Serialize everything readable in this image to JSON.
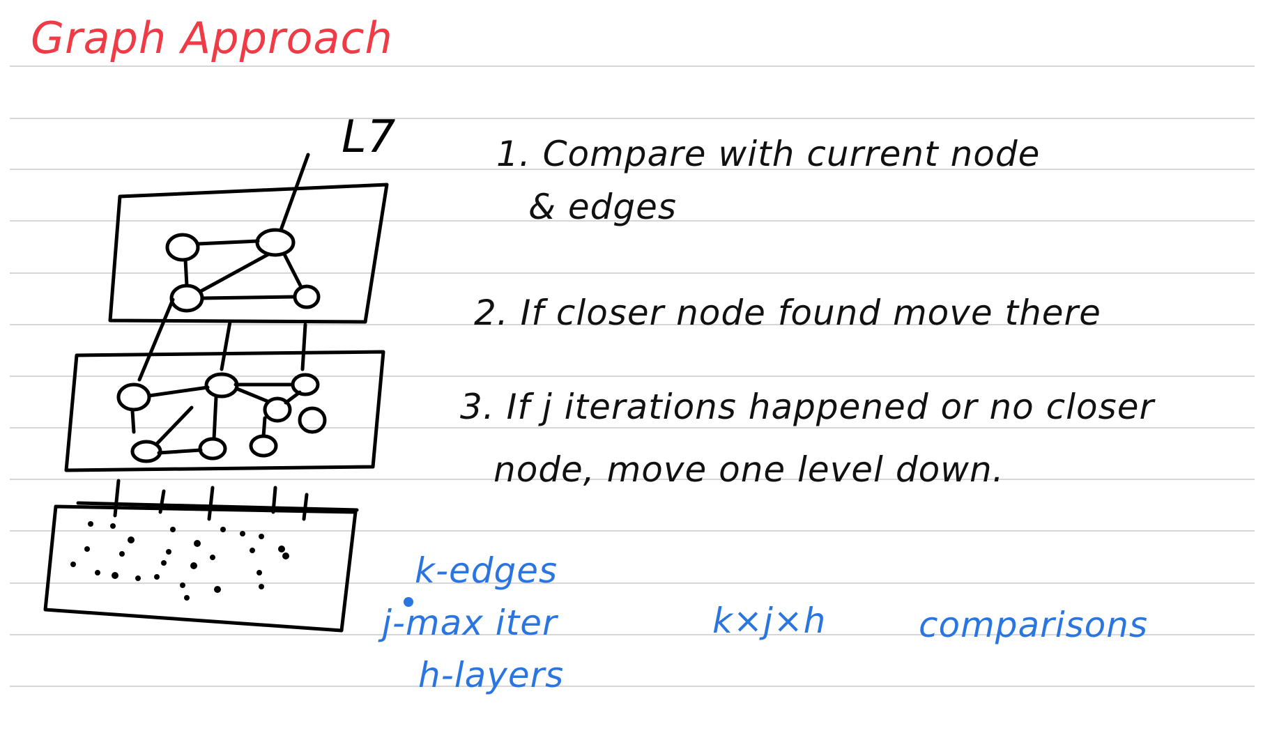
{
  "title": "Graph Approach",
  "layer_label": "L7",
  "steps": [
    {
      "line1": "1. Compare with current node",
      "line2": "& edges"
    },
    {
      "line1": "2. If closer node found move there"
    },
    {
      "line1": "3. If j iterations happened or no closer",
      "line2": "node, move one level down."
    }
  ],
  "params": {
    "k": "k-edges",
    "j": "j-max iter",
    "h": "h-layers"
  },
  "formula": "k×j×h",
  "comparisons": "comparisons",
  "colors": {
    "title": "#ef3b46",
    "ink": "#111111",
    "blue": "#2a75e0",
    "rule": "#c8c8c8"
  }
}
